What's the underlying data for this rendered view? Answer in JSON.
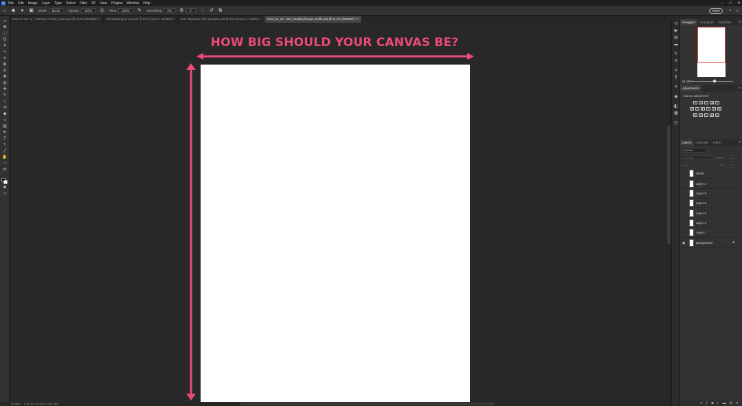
{
  "menubar": {
    "items": [
      "File",
      "Edit",
      "Image",
      "Layer",
      "Type",
      "Select",
      "Filter",
      "3D",
      "View",
      "Plugins",
      "Window",
      "Help"
    ],
    "window_controls": [
      "–",
      "□",
      "✕"
    ]
  },
  "options": {
    "mode_label": "Mode:",
    "mode_value": "Brush",
    "opacity_label": "Opacity:",
    "opacity_value": "100%",
    "flow_label": "Flow:",
    "flow_value": "100%",
    "smoothing_label": "Smoothing:",
    "smoothing_value": "0%",
    "angle_value": "0°",
    "share_label": "Share"
  },
  "tabs": [
    {
      "label": "2022-07-05 -L2 - Painting Portrait_Less1.psd @ 33,3% (RGB/8#) ×",
      "active": false
    },
    {
      "label": "058-Drawing an eye.psd @ 50% (Layer 7, RGB/8) ×",
      "active": false
    },
    {
      "label": "030- Masculine face example.psd @ 50% (Layer 2, RGB/8) ×",
      "active": false
    },
    {
      "label": "2023_01_23 - 018_Shading bargue profile.psd @ 51,5% (RGB/8#) * ×",
      "active": true
    }
  ],
  "canvas": {
    "headline": "HOW BIG SHOULD YOUR CANVAS BE?",
    "accent_color": "#ec4a76"
  },
  "status": {
    "zoom": "51,48%",
    "doc_info": "2750 px x 4761 px (300 ppi)"
  },
  "navigator": {
    "tabs": [
      "Navigator",
      "Histogram",
      "Swatches"
    ],
    "zoom": "51,48%"
  },
  "adjustments": {
    "title": "Adjustments",
    "add_label": "Add an adjustment"
  },
  "layers_panel": {
    "tabs": [
      "Layers",
      "Channels",
      "Paths"
    ],
    "filter_label": "Q Kind",
    "blend_mode": "Normal",
    "opacity_label": "Opacity:",
    "opacity_value": "100%",
    "lock_label": "Lock:",
    "fill_label": "Fill:",
    "fill_value": "100%",
    "layers": [
      {
        "name": "Wash",
        "visible": false
      },
      {
        "name": "Layer 3",
        "visible": false
      },
      {
        "name": "Layer 9",
        "visible": false
      },
      {
        "name": "Layer 8",
        "visible": false
      },
      {
        "name": "Layer 5",
        "visible": false
      },
      {
        "name": "Layer 2",
        "visible": false
      },
      {
        "name": "Layer 1",
        "visible": false
      },
      {
        "name": "Background",
        "visible": true,
        "locked": true
      }
    ]
  }
}
